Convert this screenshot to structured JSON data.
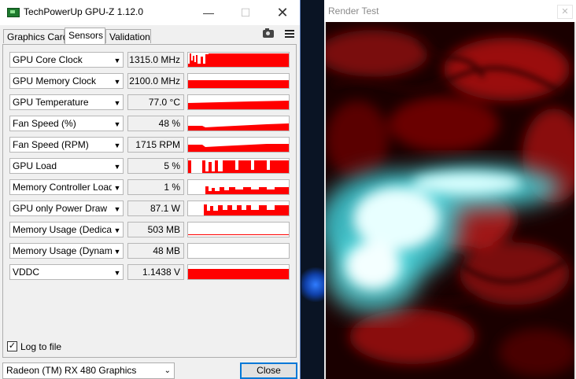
{
  "gpuz": {
    "title": "TechPowerUp GPU-Z 1.12.0",
    "window_controls": {
      "minimize": "—",
      "maximize": "☐",
      "close": "✕"
    },
    "tabs": [
      {
        "label": "Graphics Card",
        "active": false
      },
      {
        "label": "Sensors",
        "active": true
      },
      {
        "label": "Validation",
        "active": false
      }
    ],
    "sensors": [
      {
        "name": "GPU Core Clock",
        "value": "1315.0 MHz"
      },
      {
        "name": "GPU Memory Clock",
        "value": "2100.0 MHz"
      },
      {
        "name": "GPU Temperature",
        "value": "77.0 °C"
      },
      {
        "name": "Fan Speed (%)",
        "value": "48 %"
      },
      {
        "name": "Fan Speed (RPM)",
        "value": "1715 RPM"
      },
      {
        "name": "GPU Load",
        "value": "5 %"
      },
      {
        "name": "Memory Controller Load",
        "value": "1 %"
      },
      {
        "name": "GPU only Power Draw",
        "value": "87.1 W"
      },
      {
        "name": "Memory Usage (Dedicated)",
        "value": "503 MB"
      },
      {
        "name": "Memory Usage (Dynamic)",
        "value": "48 MB"
      },
      {
        "name": "VDDC",
        "value": "1.1438 V"
      }
    ],
    "dropdown_arrow": "▼",
    "log_to_file": {
      "label": "Log to file",
      "checked": true,
      "check_mark": "✓"
    },
    "gpu_select": {
      "value": "Radeon (TM) RX 480 Graphics",
      "arrow": "⌄"
    },
    "close_button": "Close",
    "colors": {
      "graph": "#ff0000",
      "accent": "#0078d7"
    }
  },
  "render_test": {
    "title": "Render Test",
    "close": "✕"
  }
}
